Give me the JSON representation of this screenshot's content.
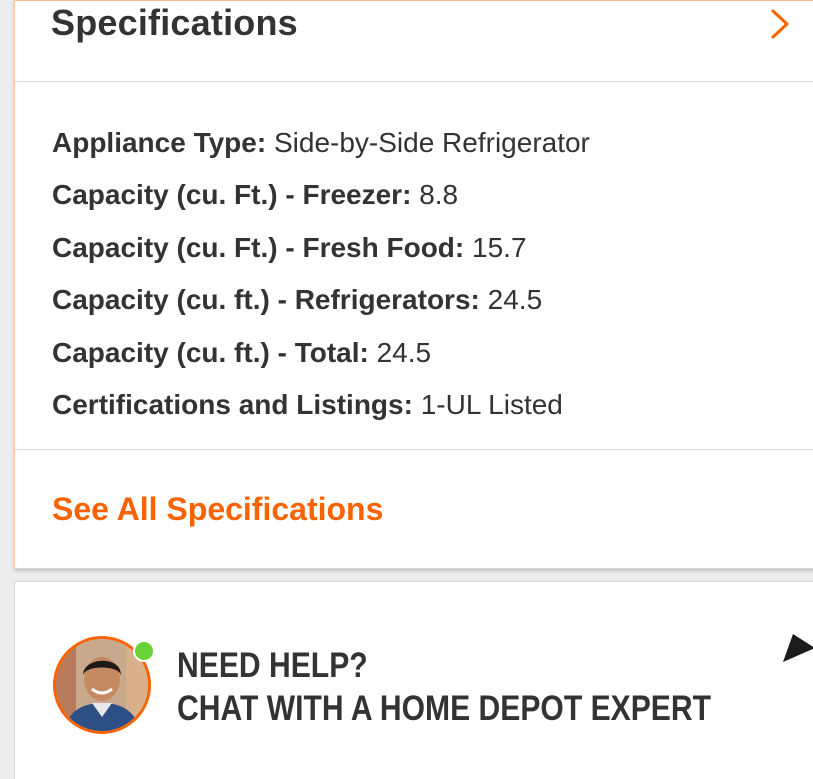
{
  "specifications": {
    "title": "Specifications",
    "chevron_icon": "chevron-right-icon",
    "accent_color": "#f96302",
    "items": [
      {
        "label": "Appliance Type:",
        "value": "Side-by-Side Refrigerator"
      },
      {
        "label": "Capacity (cu. Ft.) - Freezer:",
        "value": "8.8"
      },
      {
        "label": "Capacity (cu. Ft.) - Fresh Food:",
        "value": "15.7"
      },
      {
        "label": "Capacity (cu. ft.) - Refrigerators:",
        "value": "24.5"
      },
      {
        "label": "Capacity (cu. ft.) - Total:",
        "value": "24.5"
      },
      {
        "label": "Certifications and Listings:",
        "value": "1-UL Listed"
      }
    ],
    "see_all_label": "See All Specifications"
  },
  "help": {
    "title": "NEED HELP?",
    "subtitle": "CHAT WITH A HOME DEPOT EXPERT",
    "avatar_icon": "expert-avatar",
    "status_icon": "online-status-icon",
    "status_color": "#6ad33a",
    "arrow_icon": "arrow-icon"
  }
}
